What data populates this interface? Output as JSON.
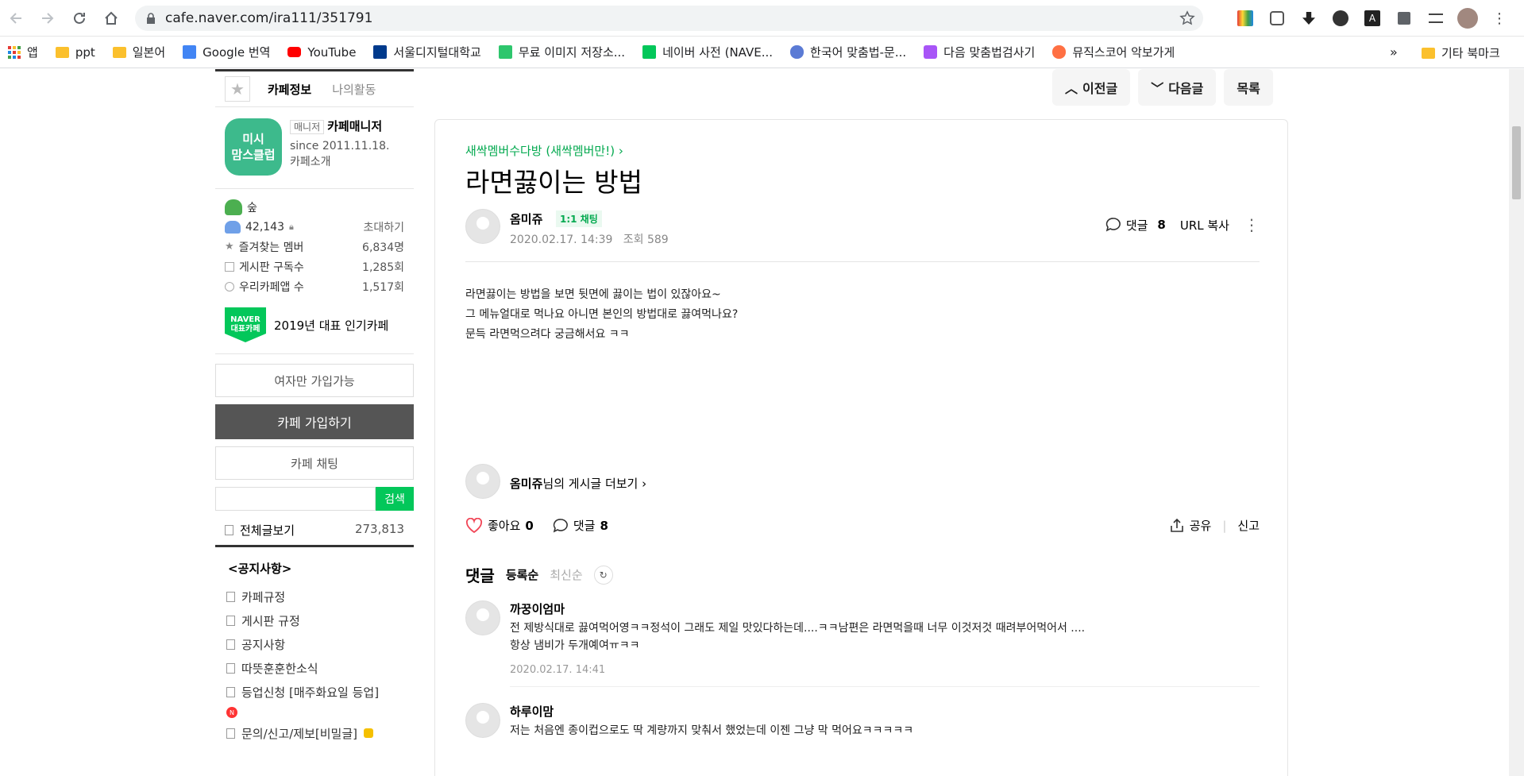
{
  "browser": {
    "url": "cafe.naver.com/ira111/351791",
    "bookmarks": [
      {
        "label": "앱",
        "icon": "apps-grid-icon"
      },
      {
        "label": "ppt",
        "icon": "folder-icon"
      },
      {
        "label": "일본어",
        "icon": "folder-icon"
      },
      {
        "label": "Google 번역",
        "icon": "google-translate-icon"
      },
      {
        "label": "YouTube",
        "icon": "youtube-icon"
      },
      {
        "label": "서울디지털대학교",
        "icon": "sdu-icon"
      },
      {
        "label": "무료 이미지 저장소...",
        "icon": "px-icon"
      },
      {
        "label": "네이버 사전 (NAVE...",
        "icon": "naver-dict-icon"
      },
      {
        "label": "한국어 맞춤법-문...",
        "icon": "spell-icon"
      },
      {
        "label": "다음 맞춤법검사기",
        "icon": "daum-icon"
      },
      {
        "label": "뮤직스코어 악보가게",
        "icon": "music-icon"
      }
    ],
    "more": "»",
    "other_bookmarks": "기타 북마크"
  },
  "sidebar": {
    "tabs": {
      "info": "카페정보",
      "activity": "나의활동"
    },
    "logo_text": "미시\n맘스클럽",
    "manager_tag": "매니저",
    "manager_name": "카페매니저",
    "since": "since 2011.11.18.",
    "intro": "카페소개",
    "level": "숲",
    "members": "42,143",
    "invite": "초대하기",
    "stats": [
      {
        "label": "즐겨찾는 멤버",
        "value": "6,834명"
      },
      {
        "label": "게시판 구독수",
        "value": "1,285회"
      },
      {
        "label": "우리카페앱 수",
        "value": "1,517회"
      }
    ],
    "award_badge_top": "NAVER",
    "award_badge_bottom": "대표카페",
    "award_text": "2019년 대표 인기카페",
    "women_only": "여자만 가입가능",
    "join": "카페 가입하기",
    "chat": "카페 채팅",
    "search_btn": "검색",
    "all_posts_label": "전체글보기",
    "all_posts_count": "273,813",
    "board_head": "<공지사항>",
    "boards": [
      "카페규정",
      "게시판 규정",
      "공지사항",
      "따뜻훈훈한소식",
      "등업신청 [매주화요일 등업]"
    ],
    "new_badge": "N",
    "inquiry": "문의/신고/제보[비밀글]"
  },
  "article_nav": {
    "prev": "이전글",
    "next": "다음글",
    "list": "목록"
  },
  "article": {
    "board": "새싹멤버수다방 (새싹멤버만!) ›",
    "title": "라면끓이는 방법",
    "author": "옴미쥬",
    "chat_tag": "1:1 채팅",
    "date": "2020.02.17. 14:39",
    "views": "조회 589",
    "comment_label": "댓글",
    "comment_count": "8",
    "url_copy": "URL 복사",
    "body": [
      "라면끓이는 방법을 보면 뒷면에 끓이는 법이 있잖아요~",
      "그 메뉴얼대로 먹나요 아니면 본인의 방법대로 끓여먹나요?",
      "문득 라면먹으려다 궁금해서요 ㅋㅋ"
    ],
    "more_author": "옴미쥬",
    "more_suffix": "님의 게시글 더보기 ›",
    "like_label": "좋아요",
    "like_count": "0",
    "share": "공유",
    "report": "신고"
  },
  "comments": {
    "heading": "댓글",
    "sort_registered": "등록순",
    "sort_latest": "최신순",
    "items": [
      {
        "name": "까꿍이엄마",
        "text": "전 제방식대로 끓여먹어영ㅋㅋ정석이 그래도 제일 맛있다하는데....ㅋㅋ남편은 라면먹을때 너무 이것저것 때려부어먹어서 ....\n항상 냄비가 두개예여ㅠㅋㅋ",
        "date": "2020.02.17. 14:41"
      },
      {
        "name": "하루이맘",
        "text": "저는 처음엔 종이컵으로도 딱 계량까지 맞춰서 했었는데 이젠 그냥 막 먹어요ㅋㅋㅋㅋㅋ",
        "date": ""
      }
    ]
  },
  "colors": {
    "naver_green": "#03c75a",
    "board_link": "#03a94f",
    "dark_button": "#555555"
  }
}
